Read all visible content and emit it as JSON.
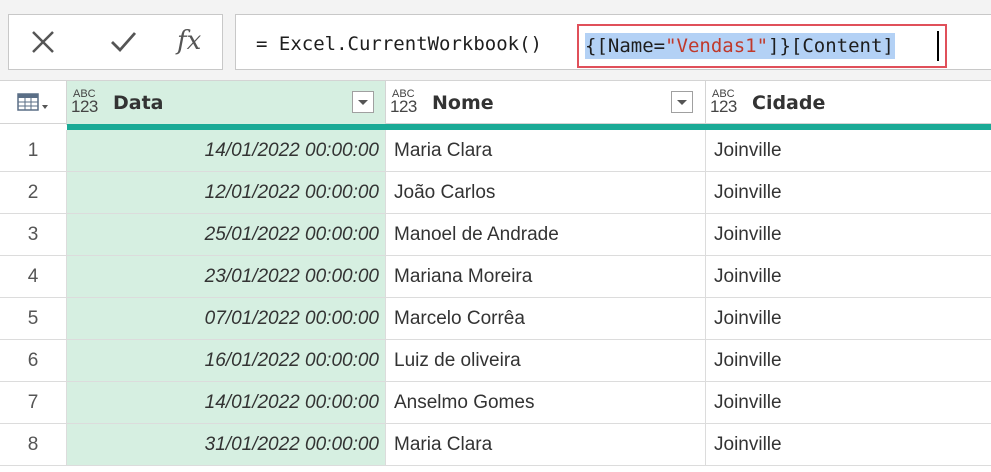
{
  "formula_bar": {
    "cancel_icon": "close-x-icon",
    "confirm_icon": "checkmark-icon",
    "fx_label": "fx",
    "formula_prefix": "= Excel.CurrentWorkbook()",
    "formula_selected_open": "{[Name=",
    "formula_selected_string": "\"Vendas1\"",
    "formula_selected_close": "]}[Content]"
  },
  "grid": {
    "corner_icon": "table-menu-icon",
    "type_icon_top": "ABC",
    "type_icon_bottom": "123",
    "columns": [
      {
        "title": "Data"
      },
      {
        "title": "Nome"
      },
      {
        "title": "Cidade"
      }
    ],
    "rows": [
      {
        "n": "1",
        "data": "14/01/2022 00:00:00",
        "nome": "Maria Clara",
        "cidade": "Joinville"
      },
      {
        "n": "2",
        "data": "12/01/2022 00:00:00",
        "nome": "João Carlos",
        "cidade": "Joinville"
      },
      {
        "n": "3",
        "data": "25/01/2022 00:00:00",
        "nome": "Manoel de Andrade",
        "cidade": "Joinville"
      },
      {
        "n": "4",
        "data": "23/01/2022 00:00:00",
        "nome": "Mariana Moreira",
        "cidade": "Joinville"
      },
      {
        "n": "5",
        "data": "07/01/2022 00:00:00",
        "nome": "Marcelo Corrêa",
        "cidade": "Joinville"
      },
      {
        "n": "6",
        "data": "16/01/2022 00:00:00",
        "nome": "Luiz de oliveira",
        "cidade": "Joinville"
      },
      {
        "n": "7",
        "data": "14/01/2022 00:00:00",
        "nome": "Anselmo Gomes",
        "cidade": "Joinville"
      },
      {
        "n": "8",
        "data": "31/01/2022 00:00:00",
        "nome": "Maria Clara",
        "cidade": "Joinville"
      }
    ]
  },
  "colors": {
    "selected_column": "#d6efe1",
    "quality_bar": "#1aaa96",
    "highlight_box": "#e0505a",
    "selection": "#b3d1f5"
  }
}
